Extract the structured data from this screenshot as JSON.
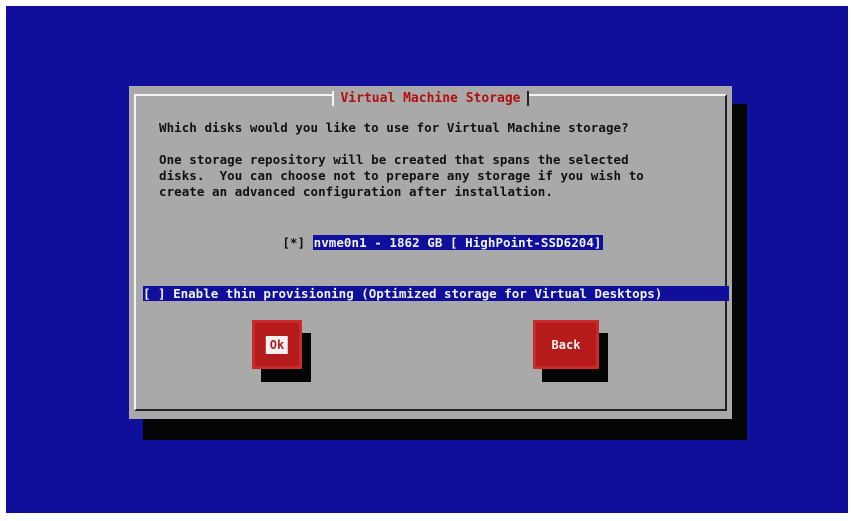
{
  "dialog": {
    "title": "Virtual Machine Storage",
    "question": "Which disks would you like to use for Virtual Machine storage?",
    "info": "One storage repository will be created that spans the selected\ndisks.  You can choose not to prepare any storage if you wish to\ncreate an advanced configuration after installation.",
    "disk": {
      "checkbox": "[*]",
      "label": "nvme0n1 - 1862 GB [ HighPoint-SSD6204]"
    },
    "thin_provisioning": {
      "checkbox": "[ ]",
      "label": "Enable thin provisioning (Optimized storage for Virtual Desktops)"
    },
    "buttons": {
      "ok": "Ok",
      "back": "Back"
    }
  },
  "colors": {
    "background": "#0f0f9c",
    "dialog": "#a9a9a9",
    "title": "#b01010",
    "button": "#b51b1b",
    "highlight": "#0f0f9c"
  }
}
